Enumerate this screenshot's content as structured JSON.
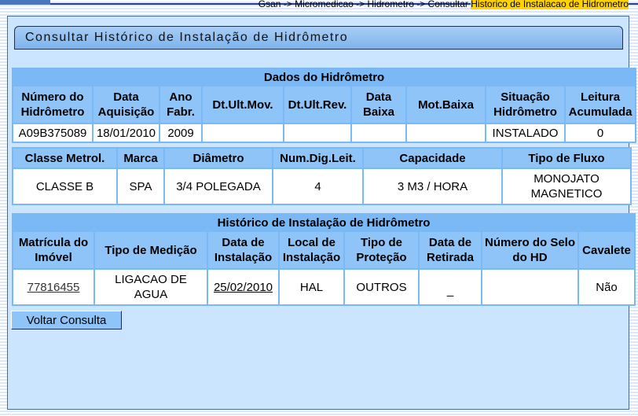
{
  "breadcrumb": {
    "text": "Gsan -> Micromedicao -> Hidrometro -> Consultar ",
    "highlight": "Historico de Instalacao de Hidrometro"
  },
  "page_title": "Consultar Histórico de Instalação de Hidrômetro",
  "dados": {
    "title": "Dados do Hidrômetro",
    "headers": [
      "Número do Hidrômetro",
      "Data Aquisição",
      "Ano Fabr.",
      "Dt.Ult.Mov.",
      "Dt.Ult.Rev.",
      "Data Baixa",
      "Mot.Baixa",
      "Situação Hidrômetro",
      "Leitura Acumulada"
    ],
    "values": [
      "A09B375089",
      "18/01/2010",
      "2009",
      "",
      "",
      "",
      "",
      "INSTALADO",
      "0"
    ]
  },
  "caracteristicas": {
    "headers": [
      "Classe Metrol.",
      "Marca",
      "Diâmetro",
      "Num.Dig.Leit.",
      "Capacidade",
      "Tipo de Fluxo"
    ],
    "values": [
      "CLASSE B",
      "SPA",
      "3/4 POLEGADA",
      "4",
      "3 M3 / HORA",
      "MONOJATO MAGNETICO"
    ]
  },
  "historico": {
    "title": "Histórico de Instalação de Hidrômetro",
    "headers": [
      "Matrícula do Imóvel",
      "Tipo de Medição",
      "Data de Instalação",
      "Local de Instalação",
      "Tipo de Proteção",
      "Data de Retirada",
      "Número do Selo do HD",
      "Cavalete"
    ],
    "rows": [
      [
        "77816455",
        "LIGACAO DE AGUA",
        "25/02/2010",
        "HAL",
        "OUTROS",
        "_",
        "",
        "Não"
      ]
    ]
  },
  "buttons": {
    "voltar": "Voltar Consulta"
  }
}
